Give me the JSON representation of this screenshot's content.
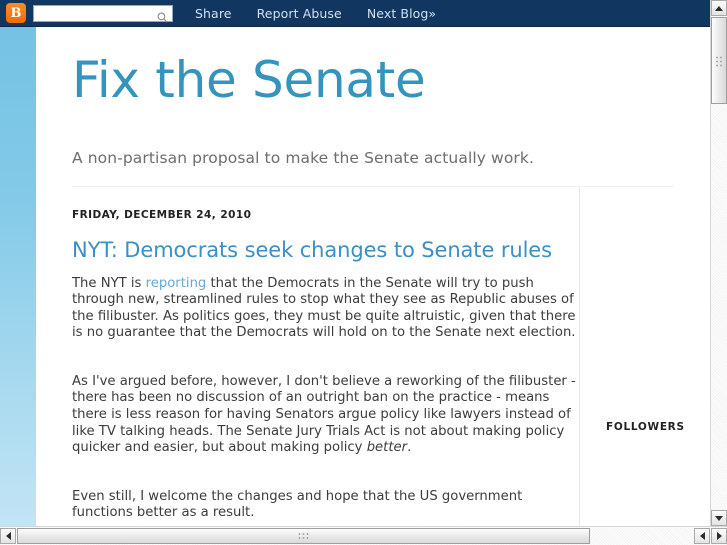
{
  "navbar": {
    "logo_letter": "B",
    "logo_name": "blogger-logo",
    "search": {
      "value": "",
      "placeholder": ""
    },
    "links": [
      {
        "label": "Share",
        "name": "navbar-link-share"
      },
      {
        "label": "Report Abuse",
        "name": "navbar-link-report-abuse"
      },
      {
        "label": "Next Blog»",
        "name": "navbar-link-next-blog"
      }
    ]
  },
  "blog": {
    "title": "Fix the Senate",
    "description": "A non-partisan proposal to make the Senate actually work.",
    "title_color": "#3494bd"
  },
  "post": {
    "date": "FRIDAY, DECEMBER 24, 2010",
    "title": "NYT: Democrats seek changes to Senate rules",
    "paragraph1_before_link": "The NYT is ",
    "paragraph1_link": "reporting",
    "paragraph1_after_link": " that the Democrats in the Senate will try to push through new, streamlined rules to stop what they see as Republic abuses of the filibuster. As politics goes, they must be quite altruistic, given that there is no guarantee that the Democrats will hold on to the Senate next election.",
    "paragraph2_before_em": "As I've argued before, however, I don't believe a reworking of the filibuster - there has been no discussion of an outright ban on the practice - means there is less reason for having Senators argue policy like lawyers instead of like TV talking heads. The Senate Jury Trials Act is not about making policy quicker and easier, but about making policy ",
    "paragraph2_em": "better",
    "paragraph2_after_em": ".",
    "paragraph3": "Even still, I welcome the changes and hope that the US government functions better as a result."
  },
  "sidebar": {
    "followers_title": "FOLLOWERS"
  },
  "scrollbars": {
    "vertical_name": "vertical-scrollbar",
    "horizontal_name": "horizontal-scrollbar"
  }
}
